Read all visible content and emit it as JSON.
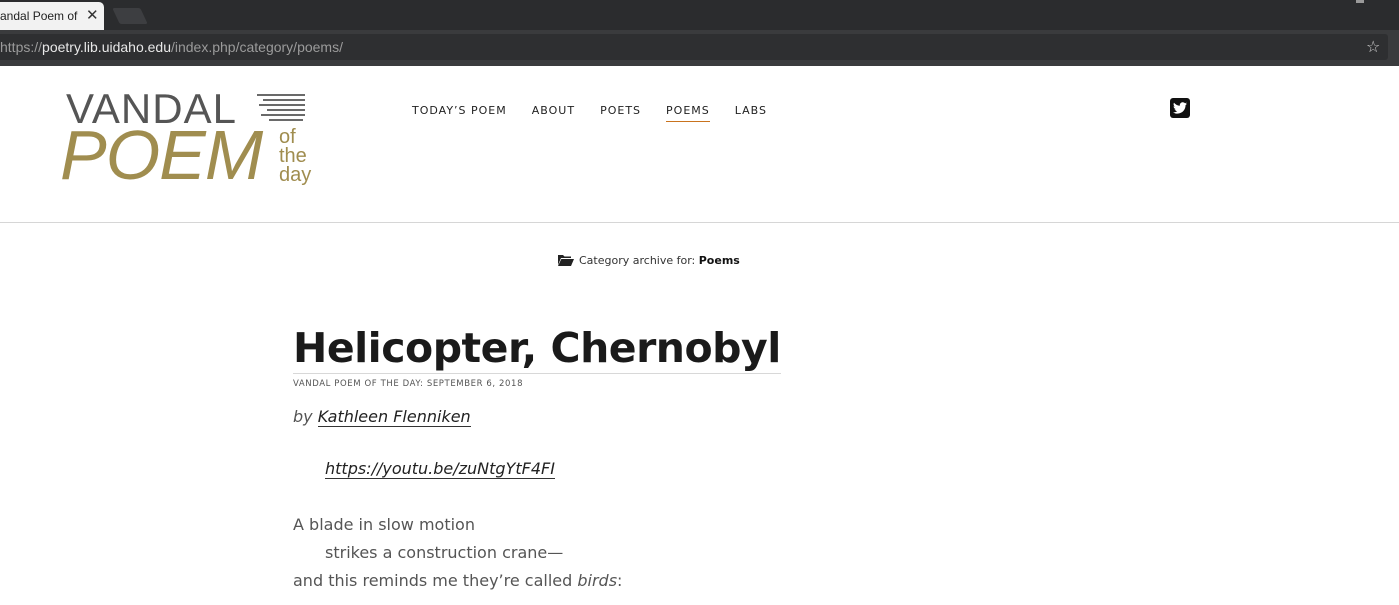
{
  "browser": {
    "tab_title": "andal Poem of t",
    "tab_close": "✕",
    "url_scheme": "https://",
    "url_host": "poetry.lib.uidaho.edu",
    "url_path": "/index.php/category/poems/"
  },
  "logo": {
    "top_word": "VANDAL",
    "main_word": "POEM",
    "of": "of",
    "the": "the",
    "day": "day"
  },
  "nav": {
    "items": [
      {
        "label": "TODAY’S POEM"
      },
      {
        "label": "ABOUT"
      },
      {
        "label": "POETS"
      },
      {
        "label": "POEMS"
      },
      {
        "label": "LABS"
      }
    ]
  },
  "archive": {
    "prefix": "Category archive for: ",
    "category": "Poems"
  },
  "post": {
    "title": "Helicopter, Chernobyl",
    "meta": "VANDAL POEM OF THE DAY: SEPTEMBER 6, 2018",
    "by": "by ",
    "author": "Kathleen Flenniken",
    "video_url": "https://youtu.be/zuNtgYtF4FI",
    "lines": [
      "A blade in slow motion",
      "strikes a construction crane—",
      "and this reminds me they’re called ",
      "birds",
      ":"
    ]
  },
  "colors": {
    "logo_gold": "#a08d4f",
    "logo_gray": "#555555",
    "nav_active_underline": "#c9731e",
    "browser_dark": "#2b2c2e"
  },
  "icons": [
    "close-icon",
    "star-icon",
    "twitter-icon",
    "folder-open-icon"
  ]
}
